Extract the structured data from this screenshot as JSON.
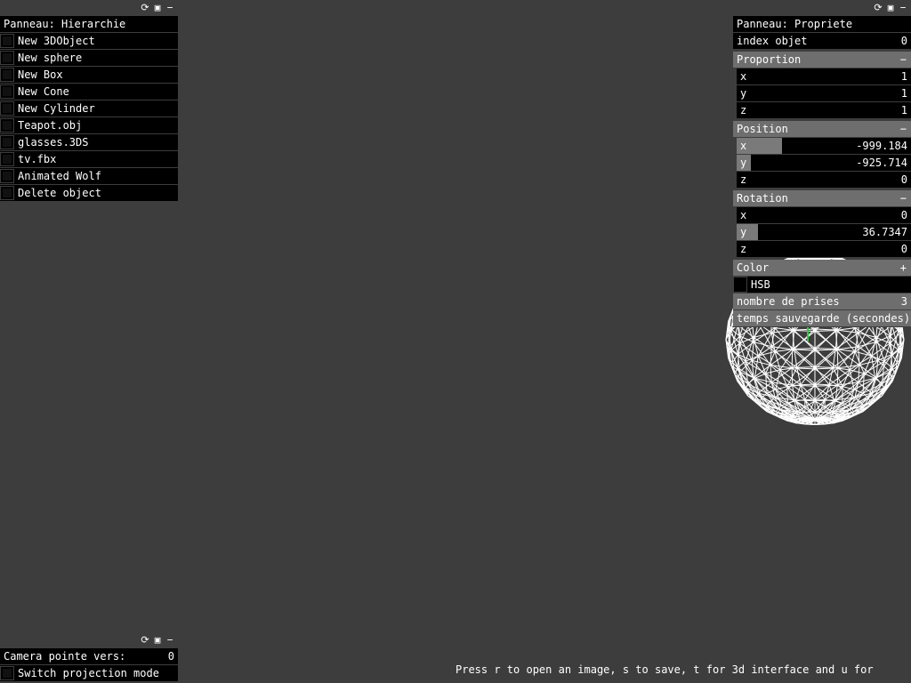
{
  "hierarchy_panel": {
    "title": "Panneau: Hierarchie",
    "items": [
      {
        "label": "New 3DObject"
      },
      {
        "label": "New sphere"
      },
      {
        "label": "New Box"
      },
      {
        "label": "New Cone"
      },
      {
        "label": "New Cylinder"
      },
      {
        "label": "Teapot.obj"
      },
      {
        "label": "glasses.3DS"
      },
      {
        "label": "tv.fbx"
      },
      {
        "label": "Animated Wolf"
      },
      {
        "label": "Delete object"
      }
    ]
  },
  "property_panel": {
    "title": "Panneau: Propriete",
    "index_label": "index objet",
    "index_value": "0",
    "proportion": {
      "title": "Proportion",
      "sign": "−",
      "x": {
        "label": "x",
        "value": "1",
        "fill": 0.0
      },
      "y": {
        "label": "y",
        "value": "1",
        "fill": 0.0
      },
      "z": {
        "label": "z",
        "value": "1",
        "fill": 0.0
      }
    },
    "position": {
      "title": "Position",
      "sign": "−",
      "x": {
        "label": "x",
        "value": "-999.184",
        "fill": 0.26
      },
      "y": {
        "label": "y",
        "value": "-925.714",
        "fill": 0.08
      },
      "z": {
        "label": "z",
        "value": "0"
      }
    },
    "rotation": {
      "title": "Rotation",
      "sign": "−",
      "x": {
        "label": "x",
        "value": "0"
      },
      "y": {
        "label": "y",
        "value": "36.7347",
        "fill": 0.12
      },
      "z": {
        "label": "z",
        "value": "0"
      }
    },
    "color": {
      "title": "Color",
      "sign": "+"
    },
    "hsb_label": "HSB",
    "captures": {
      "label": "nombre de prises",
      "value": "3"
    },
    "save_time": {
      "label": "temps sauvegarde (secondes)"
    }
  },
  "camera_panel": {
    "camera_label": "Camera pointe vers:",
    "camera_value": "0",
    "projection_label": "Switch projection mode"
  },
  "panel_icons": {
    "refresh": "⟳",
    "save": "▣",
    "minimize": "−"
  },
  "status_text": "Press r to open an image, s to save, t for 3d interface and u for"
}
